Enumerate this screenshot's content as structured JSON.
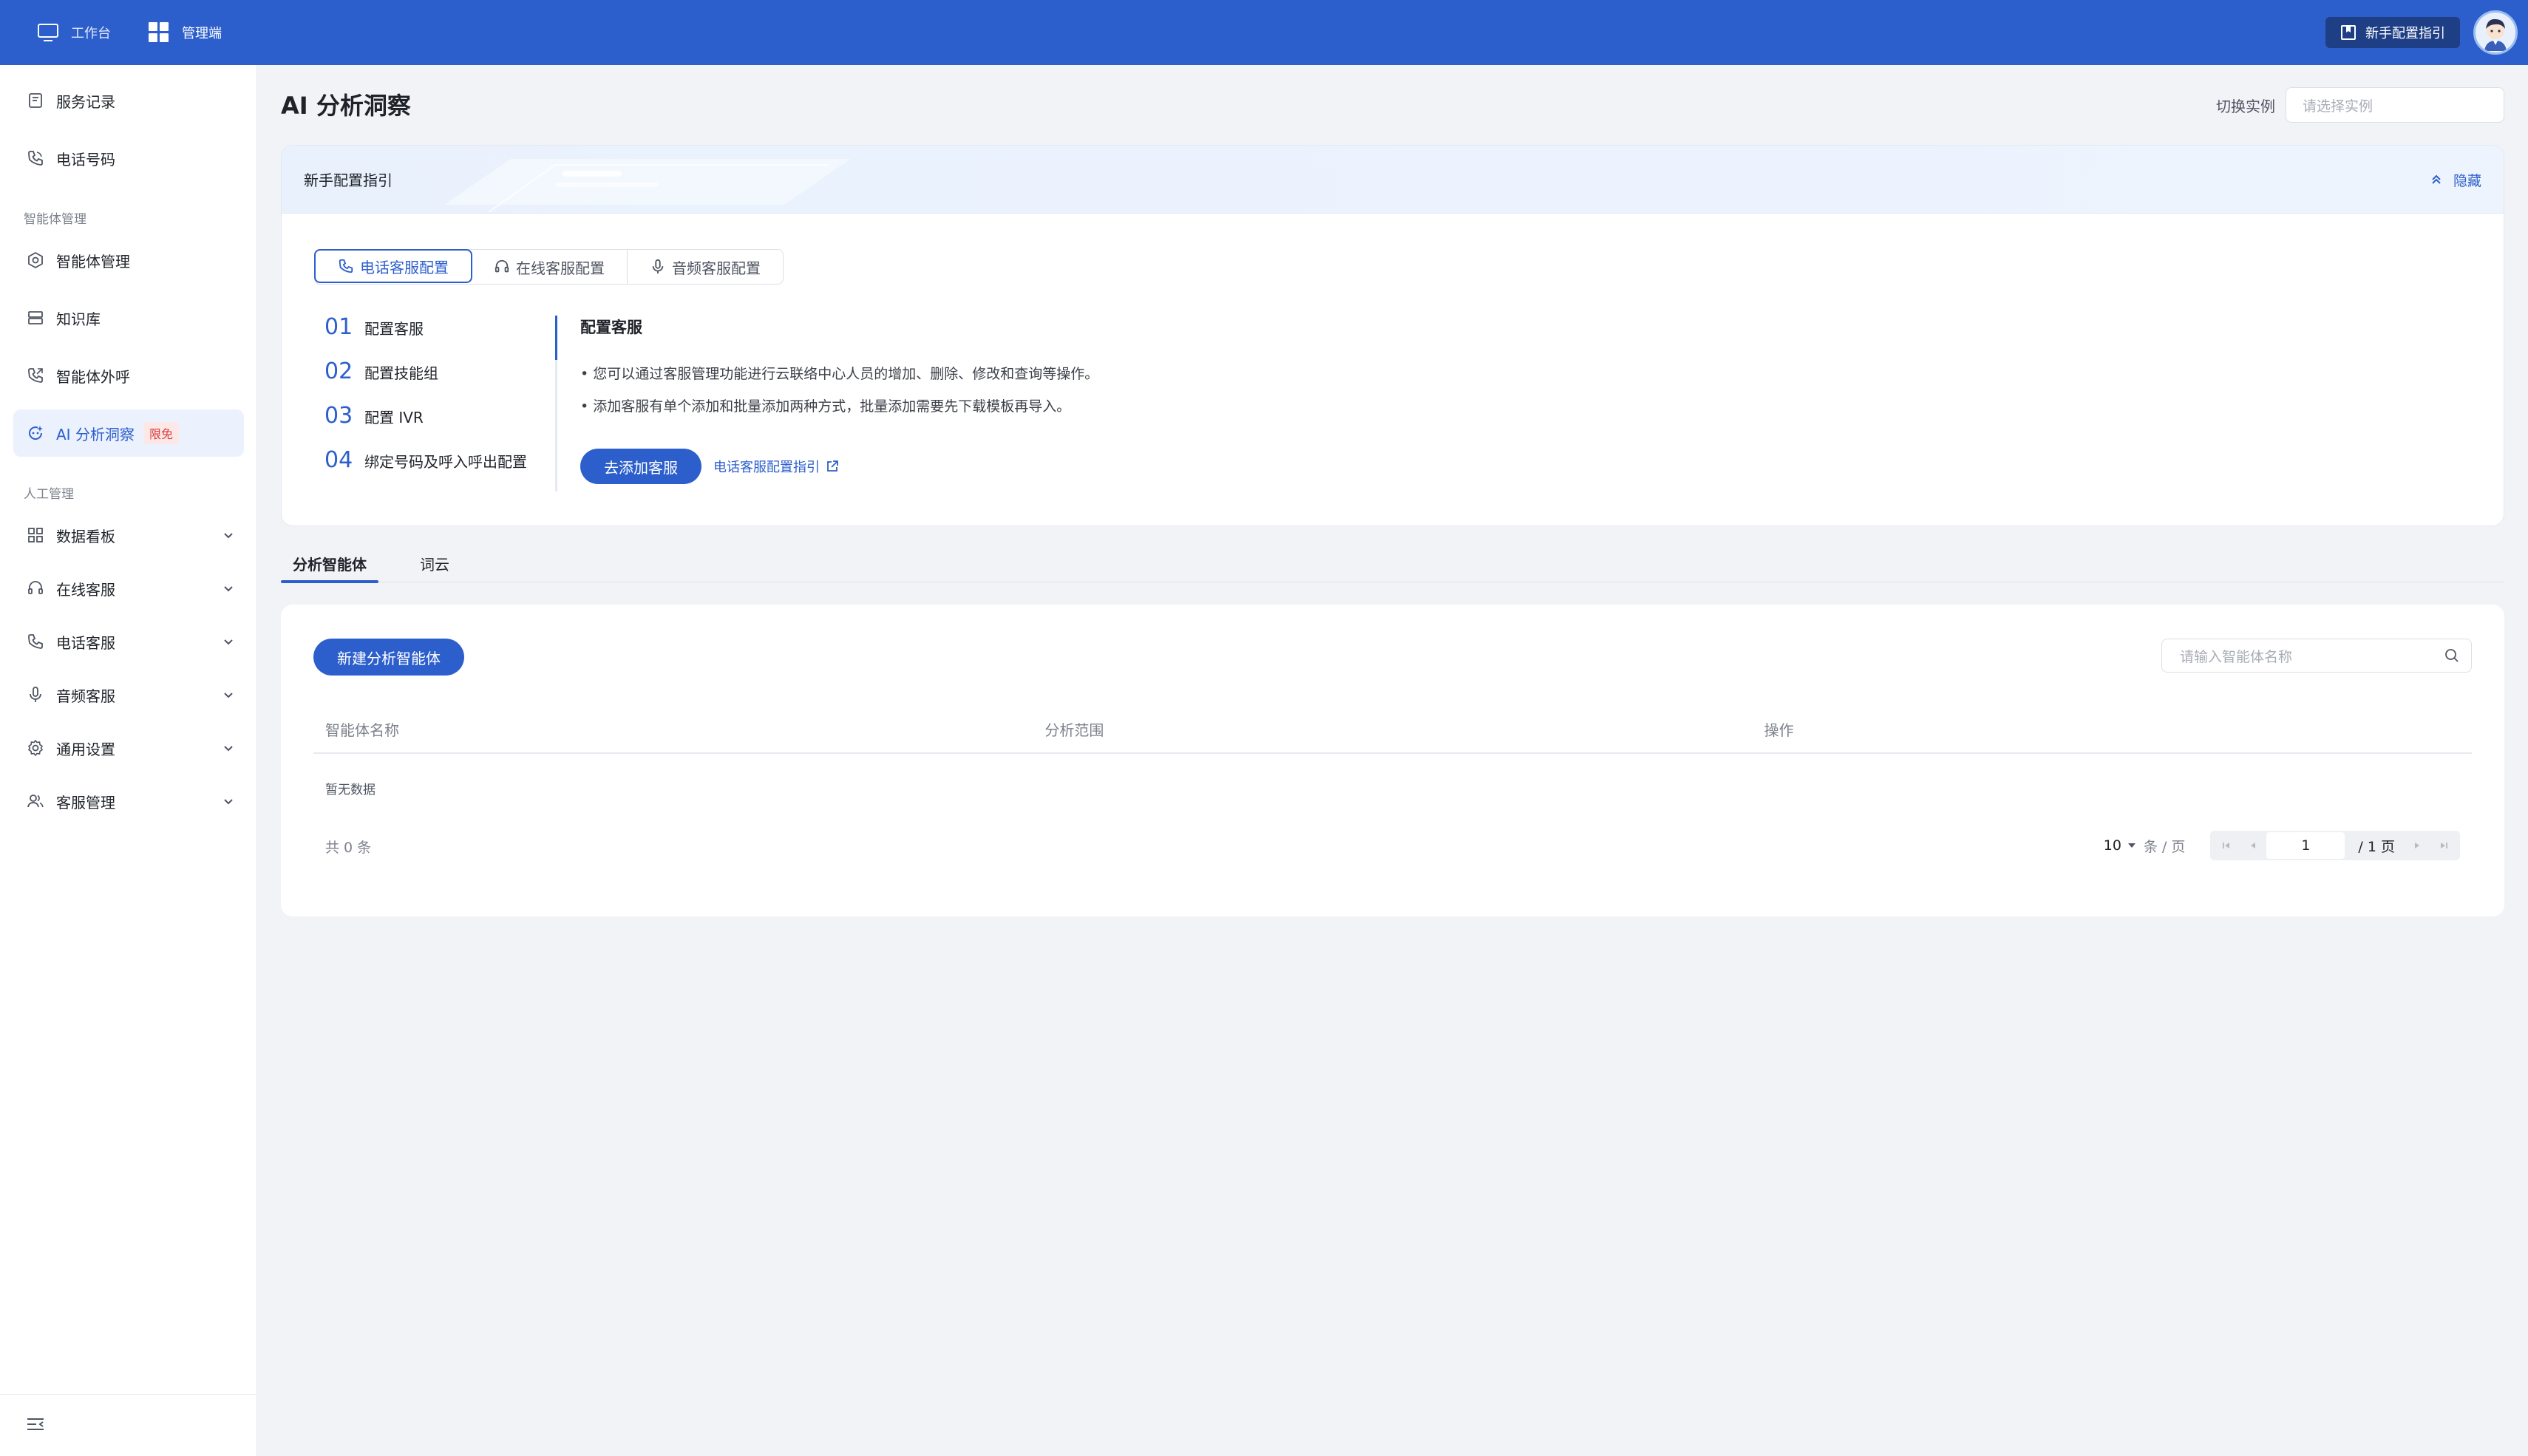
{
  "topbar": {
    "tabs": [
      {
        "label": "工作台",
        "icon": "monitor-icon"
      },
      {
        "label": "管理端",
        "icon": "grid-icon"
      }
    ],
    "guide_label": "新手配置指引"
  },
  "sidebar": {
    "items": [
      {
        "label": "服务记录"
      },
      {
        "label": "电话号码"
      },
      {
        "label": "智能体管理"
      },
      {
        "label": "知识库"
      },
      {
        "label": "智能体外呼"
      },
      {
        "label": "AI 分析洞察",
        "badge": "限免"
      },
      {
        "label": "数据看板"
      },
      {
        "label": "在线客服"
      },
      {
        "label": "电话客服"
      },
      {
        "label": "音频客服"
      },
      {
        "label": "通用设置"
      },
      {
        "label": "客服管理"
      }
    ],
    "groups": [
      "智能体管理",
      "人工管理"
    ]
  },
  "page": {
    "title": "AI 分析洞察",
    "instance_label": "切换实例",
    "instance_placeholder": "请选择实例"
  },
  "guide": {
    "title": "新手配置指引",
    "hide_label": "隐藏",
    "tabs": [
      "电话客服配置",
      "在线客服配置",
      "音频客服配置"
    ],
    "steps": [
      {
        "num": "01",
        "label": "配置客服"
      },
      {
        "num": "02",
        "label": "配置技能组"
      },
      {
        "num": "03",
        "label": "配置 IVR"
      },
      {
        "num": "04",
        "label": "绑定号码及呼入呼出配置"
      }
    ],
    "detail": {
      "title": "配置客服",
      "bullets": [
        "• 您可以通过客服管理功能进行云联络中心人员的增加、删除、修改和查询等操作。",
        "• 添加客服有单个添加和批量添加两种方式，批量添加需要先下载模板再导入。"
      ],
      "action": "去添加客服",
      "link": "电话客服配置指引"
    }
  },
  "tabs": [
    "分析智能体",
    "词云"
  ],
  "list": {
    "new_button": "新建分析智能体",
    "search_placeholder": "请输入智能体名称",
    "columns": [
      "智能体名称",
      "分析范围",
      "操作"
    ],
    "empty_text": "暂无数据",
    "total": "共 0 条",
    "page_size": "10",
    "page_size_unit": "条 / 页",
    "current_page": "1",
    "total_pages": "/ 1 页"
  }
}
